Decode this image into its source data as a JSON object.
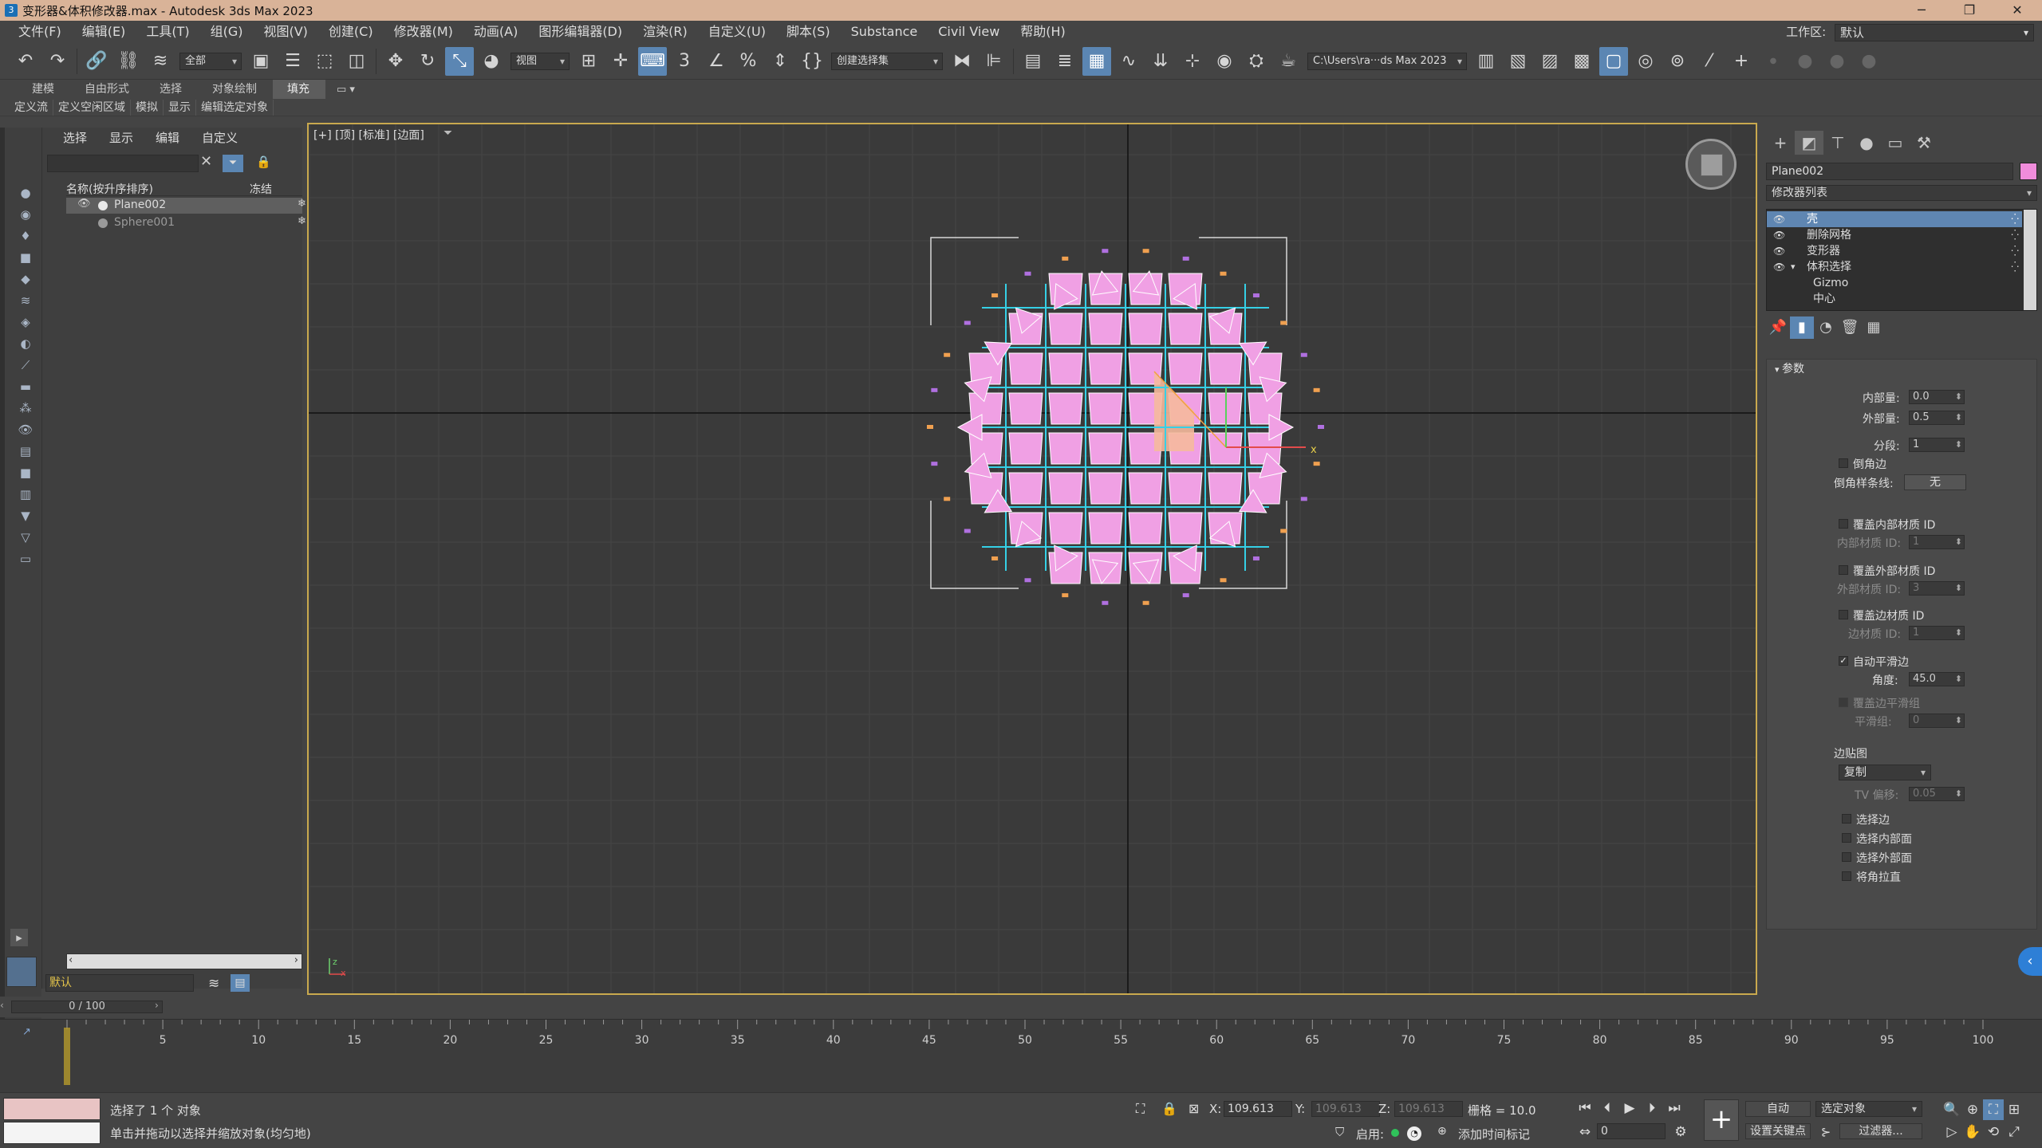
{
  "titlebar": {
    "title": "变形器&体积修改器.max - Autodesk 3ds Max 2023",
    "app_icon": "3",
    "minimize": "─",
    "restore": "❐",
    "close": "✕"
  },
  "menubar": {
    "items": [
      "文件(F)",
      "编辑(E)",
      "工具(T)",
      "组(G)",
      "视图(V)",
      "创建(C)",
      "修改器(M)",
      "动画(A)",
      "图形编辑器(D)",
      "渲染(R)",
      "自定义(U)",
      "脚本(S)",
      "Substance",
      "Civil View",
      "帮助(H)"
    ],
    "workspace_label": "工作区:",
    "workspace_value": "默认"
  },
  "toolbar": {
    "filter_value": "全部",
    "view_value": "视图",
    "selection_set_placeholder": "创建选择集",
    "path_value": "C:\\Users\\ra···ds Max 2023"
  },
  "ribbon": {
    "tabs": [
      "建模",
      "自由形式",
      "选择",
      "对象绘制",
      "填充"
    ],
    "active_tab": "填充",
    "sub_items": [
      "定义流",
      "定义空闲区域",
      "模拟",
      "显示",
      "编辑选定对象"
    ]
  },
  "explorer": {
    "tabs": [
      "选择",
      "显示",
      "编辑",
      "自定义"
    ],
    "col_name": "名称(按升序排序)",
    "col_freeze": "冻结",
    "rows": [
      {
        "name": "Plane002"
      },
      {
        "name": "Sphere001"
      }
    ],
    "layer_value": "默认"
  },
  "viewport": {
    "label": "[+] [顶] [标准] [边面]",
    "axis_x": "x",
    "gizmo_z": "z",
    "gizmo_x": "x",
    "mesh_color": "#f0a0e4",
    "wire_color": "#35d0e6"
  },
  "cmdpanel": {
    "object_name": "Plane002",
    "object_color": "#f08cdb",
    "modifier_list": "修改器列表",
    "stack": [
      {
        "label": "壳",
        "selected": true
      },
      {
        "label": "删除网格"
      },
      {
        "label": "变形器"
      },
      {
        "label": "体积选择"
      },
      {
        "label": "Gizmo"
      },
      {
        "label": "中心"
      }
    ],
    "rollout_title": "参数",
    "inner_amount_label": "内部量:",
    "inner_amount": "0.0",
    "outer_amount_label": "外部量:",
    "outer_amount": "0.5",
    "segments_label": "分段:",
    "segments": "1",
    "bevel_edges": "倒角边",
    "bevel_spline_label": "倒角样条线:",
    "bevel_spline_btn": "无",
    "override_inner": "覆盖内部材质 ID",
    "inner_mat_label": "内部材质 ID:",
    "inner_mat": "1",
    "override_outer": "覆盖外部材质 ID",
    "outer_mat_label": "外部材质 ID:",
    "outer_mat": "3",
    "override_edge": "覆盖边材质 ID",
    "edge_mat_label": "边材质 ID:",
    "edge_mat": "1",
    "auto_smooth": "自动平滑边",
    "angle_label": "角度:",
    "angle": "45.0",
    "override_edge_smooth": "覆盖边平滑组",
    "smooth_group_label": "平滑组:",
    "smooth_group": "0",
    "edge_map_label": "边贴图",
    "edge_map_value": "复制",
    "tv_offset_label": "TV 偏移:",
    "tv_offset": "0.05",
    "select_edges": "选择边",
    "select_inner": "选择内部面",
    "select_outer": "选择外部面",
    "straighten_corners": "将角拉直"
  },
  "timeline": {
    "frame_display": "0 / 100",
    "ticks": [
      "5",
      "10",
      "15",
      "20",
      "25",
      "30",
      "35",
      "40",
      "45",
      "50",
      "55",
      "60",
      "65",
      "70",
      "75",
      "80",
      "85",
      "90",
      "95",
      "100"
    ]
  },
  "status": {
    "selected_text": "选择了 1 个 对象",
    "hint_text": "单击并拖动以选择并缩放对象(均匀地)",
    "x_label": "X:",
    "x_value": "109.613",
    "y_label": "Y:",
    "y_value": "109.613",
    "z_label": "Z:",
    "z_value": "109.613",
    "grid_text": "栅格 = 10.0",
    "auto_btn": "自动",
    "selected_obj": "选定对象",
    "set_key_btn": "设置关键点",
    "filter_btn": "过滤器...",
    "enable_label": "启用:",
    "add_time_tag": "添加时间标记",
    "frame_value": "0"
  }
}
